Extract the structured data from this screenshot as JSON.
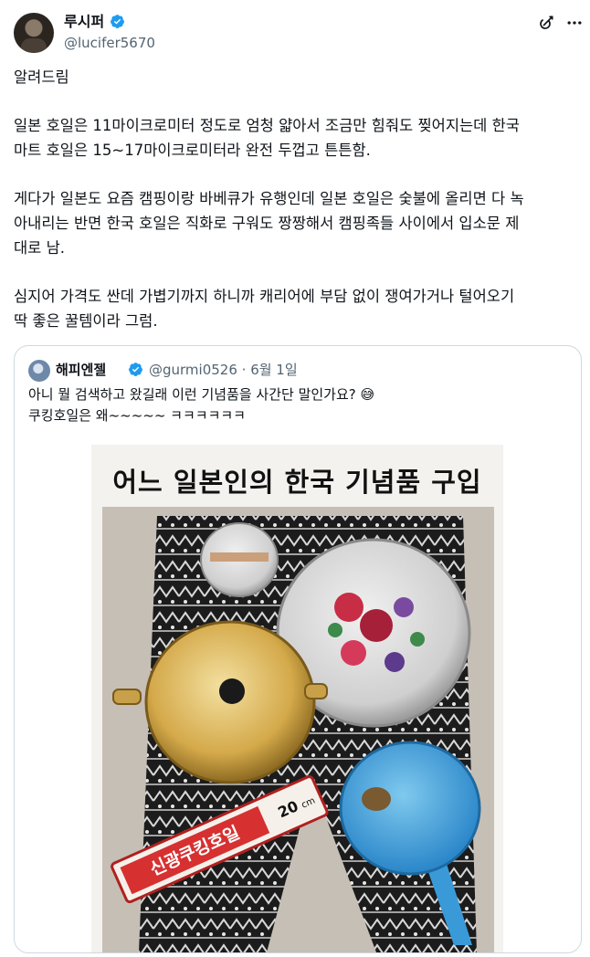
{
  "author": {
    "name": "루시퍼",
    "handle": "@lucifer5670",
    "verified_color": "#1d9bf0"
  },
  "icons": [
    "grok-icon",
    "more-icon",
    "verified-badge-icon"
  ],
  "post": {
    "paragraphs": [
      "알려드림",
      "일본 호일은 11마이크로미터 정도로 엄청 얇아서 조금만 힘줘도 찢어지는데 한국\n마트 호일은 15~17마이크로미터라 완전 두껍고 튼튼함.",
      "게다가 일본도 요즘 캠핑이랑 바베큐가 유행인데 일본 호일은 숯불에 올리면 다 녹\n아내리는 반면 한국 호일은 직화로 구워도 짱짱해서 캠핑족들 사이에서 입소문 제\n대로 남.",
      "심지어 가격도 싼데 가볍기까지 하니까 캐리어에 부담 없이 쟁여가거나 털어오기\n딱 좋은 꿀템이라 그럼."
    ]
  },
  "quote": {
    "name": "해피엔젤",
    "meta": "@gurmi0526 · 6월 1일",
    "lines": [
      "아니 뭘 검색하고 왔길래 이런 기념품을 사간단 말인가요? 😅",
      "쿠킹호일은 왜~~~~~ ㅋㅋㅋㅋㅋㅋ"
    ],
    "image": {
      "title": "어느 일본인의 한국 기념품 구입",
      "foil_box_label": "신광쿠킹호일",
      "foil_box_size": "20",
      "foil_box_unit": "cm"
    }
  }
}
